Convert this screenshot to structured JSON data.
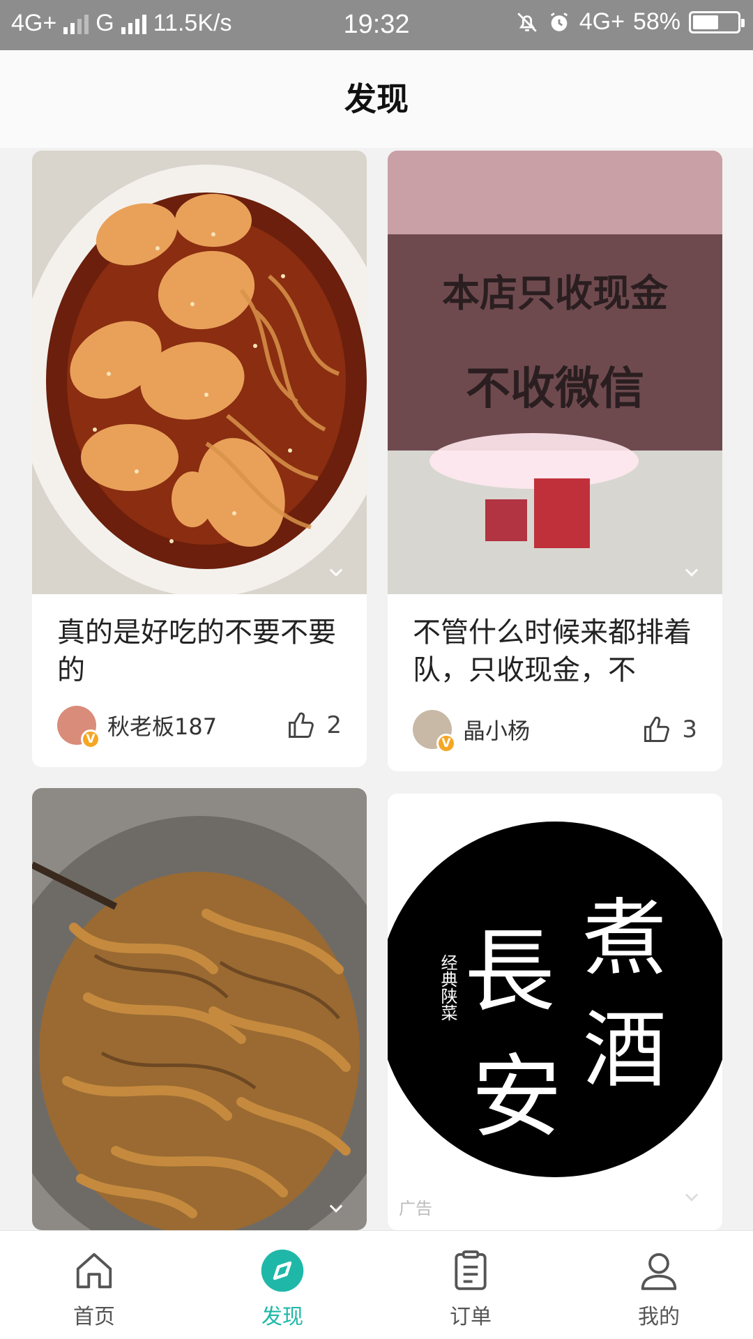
{
  "status_bar": {
    "network1": "4G+",
    "network2": "G",
    "speed": "11.5K/s",
    "time": "19:32",
    "network3": "4G+",
    "battery": "58%",
    "battery_level": 0.58
  },
  "header": {
    "title": "发现"
  },
  "feed": [
    {
      "title": "真的是好吃的不要不要的",
      "user": "秋老板187",
      "likes": "2",
      "badge": "V"
    },
    {
      "title": "不管什么时候来都排着队，只收现金，不",
      "user": "晶小杨",
      "likes": "3",
      "badge": "V",
      "sign_line1": "本店只收现金",
      "sign_line2": "不收微信"
    },
    {
      "title": ""
    },
    {
      "ad_label": "广告",
      "logo_main1": "長",
      "logo_main2": "安",
      "logo_main3": "煮",
      "logo_main4": "酒",
      "logo_sub": "经典陕菜"
    }
  ],
  "nav": {
    "items": [
      {
        "label": "首页",
        "icon": "home-icon"
      },
      {
        "label": "发现",
        "icon": "compass-icon"
      },
      {
        "label": "订单",
        "icon": "order-icon"
      },
      {
        "label": "我的",
        "icon": "profile-icon"
      }
    ],
    "active_color": "#1fb8a8"
  }
}
